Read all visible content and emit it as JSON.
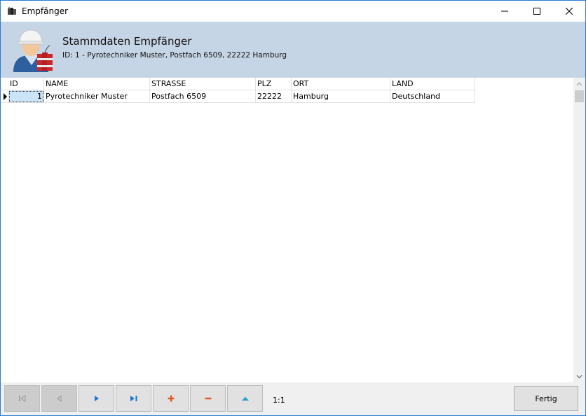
{
  "window": {
    "title": "Empfänger"
  },
  "banner": {
    "title": "Stammdaten Empfänger",
    "subtitle": "ID: 1 - Pyrotechniker Muster, Postfach 6509, 22222 Hamburg",
    "icon": "worker-with-dynamite-icon"
  },
  "grid": {
    "columns": [
      "ID",
      "NAME",
      "STRASSE",
      "PLZ",
      "ORT",
      "LAND"
    ],
    "rows": [
      [
        "1",
        "Pyrotechniker Muster",
        "Postfach 6509",
        "22222",
        "Hamburg",
        "Deutschland"
      ]
    ]
  },
  "navigator": {
    "buttons": [
      {
        "name": "first-record",
        "icon": "first-record-icon",
        "enabled": false
      },
      {
        "name": "previous-record",
        "icon": "previous-record-icon",
        "enabled": false
      },
      {
        "name": "next-record",
        "icon": "next-record-icon",
        "enabled": true
      },
      {
        "name": "last-record",
        "icon": "last-record-icon",
        "enabled": true
      },
      {
        "name": "insert-record",
        "icon": "plus-icon",
        "enabled": true
      },
      {
        "name": "delete-record",
        "icon": "minus-icon",
        "enabled": true
      },
      {
        "name": "post-edit",
        "icon": "up-triangle-icon",
        "enabled": true
      }
    ],
    "position": "1:1"
  },
  "actions": {
    "done_label": "Fertig"
  },
  "colors": {
    "banner_bg": "#c5d5e6",
    "accent_blue": "#1e73d6",
    "accent_orange": "#e2561c",
    "accent_teal": "#2aa2c7",
    "window_border": "#2b79d6"
  }
}
